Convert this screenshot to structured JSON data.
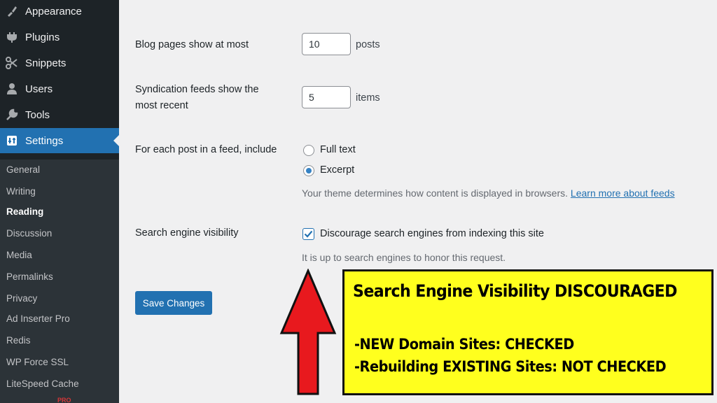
{
  "sidebar": {
    "items": [
      {
        "label": "Appearance",
        "icon": "paintbrush-icon"
      },
      {
        "label": "Plugins",
        "icon": "plugin-icon"
      },
      {
        "label": "Snippets",
        "icon": "scissors-icon"
      },
      {
        "label": "Users",
        "icon": "user-icon"
      },
      {
        "label": "Tools",
        "icon": "wrench-icon"
      },
      {
        "label": "Settings",
        "icon": "settings-icon",
        "active": true
      }
    ],
    "submenu": [
      {
        "label": "General"
      },
      {
        "label": "Writing"
      },
      {
        "label": "Reading",
        "current": true
      },
      {
        "label": "Discussion"
      },
      {
        "label": "Media"
      },
      {
        "label": "Permalinks"
      },
      {
        "label": "Privacy"
      },
      {
        "label": "Ad Inserter Pro"
      },
      {
        "label": "Redis"
      },
      {
        "label": "WP Force SSL"
      },
      {
        "label": "LiteSpeed Cache"
      }
    ],
    "badge": "PRO"
  },
  "form": {
    "blog_pages": {
      "label": "Blog pages show at most",
      "value": "10",
      "unit": "posts"
    },
    "syndication": {
      "label_line1": "Syndication feeds show the",
      "label_line2": "most recent",
      "value": "5",
      "unit": "items"
    },
    "feed_include": {
      "label": "For each post in a feed, include",
      "option_full": "Full text",
      "option_excerpt": "Excerpt",
      "selected": "Excerpt",
      "description": "Your theme determines how content is displayed in browsers.",
      "link": "Learn more about feeds"
    },
    "search_visibility": {
      "label": "Search engine visibility",
      "checkbox_label": "Discourage search engines from indexing this site",
      "checked": true,
      "description": "It is up to search engines to honor this request."
    },
    "save_label": "Save Changes"
  },
  "annotation": {
    "title": "Search Engine Visibility DISCOURAGED",
    "line1": "-NEW Domain Sites: CHECKED",
    "line2": "-Rebuilding EXISTING Sites: NOT CHECKED",
    "arrow_color": "#e8191e",
    "box_color": "#ffff1e"
  },
  "colors": {
    "sidebar_bg": "#1d2327",
    "accent": "#2271b1",
    "page_bg": "#f0f0f1"
  }
}
